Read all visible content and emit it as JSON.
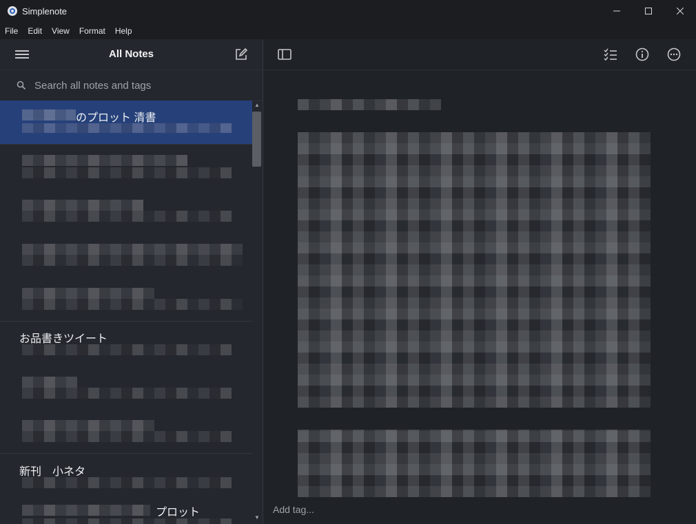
{
  "window": {
    "title": "Simplenote",
    "minimize": "—",
    "maximize": "☐",
    "close": "✕"
  },
  "menu": [
    "File",
    "Edit",
    "View",
    "Format",
    "Help"
  ],
  "sidebar": {
    "title": "All Notes",
    "search_placeholder": "Search all notes and tags"
  },
  "notes": [
    {
      "title": "のプロット 清書",
      "selected": true
    },
    {
      "title": "",
      "selected": false
    },
    {
      "title": "お品書きツイート",
      "selected": false
    },
    {
      "title": "新刊　小ネタ",
      "selected": false
    },
    {
      "title": "プロット",
      "selected": false
    }
  ],
  "editor": {
    "tag_placeholder": "Add tag..."
  },
  "colors": {
    "accent": "#26417a",
    "background": "#1f2227",
    "sidebar": "#24272d"
  },
  "icons": [
    "menu-icon",
    "new-note-icon",
    "search-icon",
    "sidebar-toggle-icon",
    "checklist-icon",
    "info-icon",
    "more-icon"
  ]
}
